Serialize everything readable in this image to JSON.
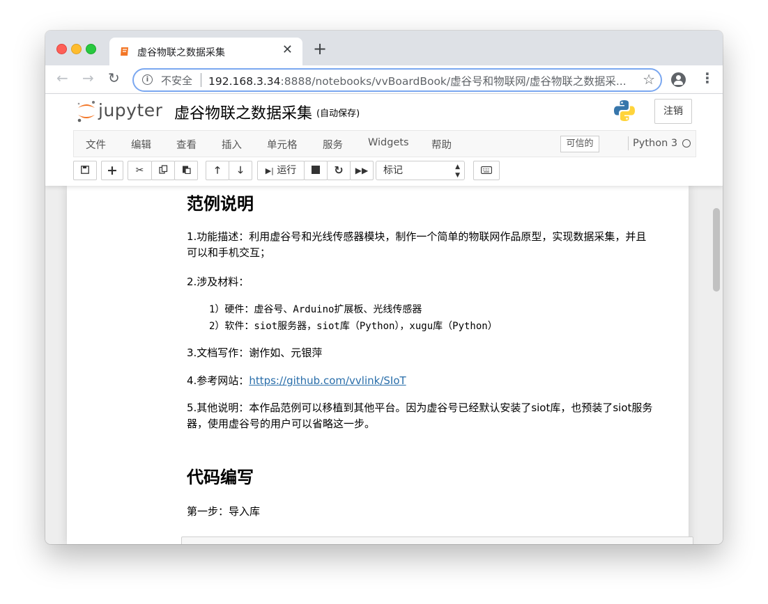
{
  "browser": {
    "tab_title": "虚谷物联之数据采集",
    "security_label": "不安全",
    "url_host": "192.168.3.34",
    "url_rest": ":8888/notebooks/vvBoardBook/虚谷号和物联网/虚谷物联之数据采..."
  },
  "jupyter": {
    "logo_text": "jupyter",
    "notebook_title": "虚谷物联之数据采集",
    "autosave": "(自动保存)",
    "logout_label": "注销",
    "menu": [
      "文件",
      "编辑",
      "查看",
      "插入",
      "单元格",
      "服务",
      "Widgets",
      "帮助"
    ],
    "trusted_label": "可信的",
    "kernel_name": "Python 3",
    "run_label": "运行",
    "cell_type": "标记"
  },
  "notebook": {
    "heading1": "范例说明",
    "p1_line1": "1.功能描述：利用虚谷号和光线传感器模块，制作一个简单的物联网作品原型，实现数据采集，并且",
    "p1_line2": "可以和手机交互；",
    "p2": "2.涉及材料：",
    "item1": "1）硬件：虚谷号、Arduino扩展板、光线传感器",
    "item2": "2）软件：siot服务器，siot库（Python），xugu库（Python）",
    "p3": "3.文档写作：谢作如、元银萍",
    "p4_label": "4.参考网站：",
    "p4_link": "https://github.com/vvlink/SIoT",
    "p5_line1": "5.其他说明：本作品范例可以移植到其他平台。因为虚谷号已经默认安装了siot库，也预装了siot服务",
    "p5_line2": "器，使用虚谷号的用户可以省略这一步。",
    "heading2": "代码编写",
    "step1": "第一步：导入库"
  }
}
